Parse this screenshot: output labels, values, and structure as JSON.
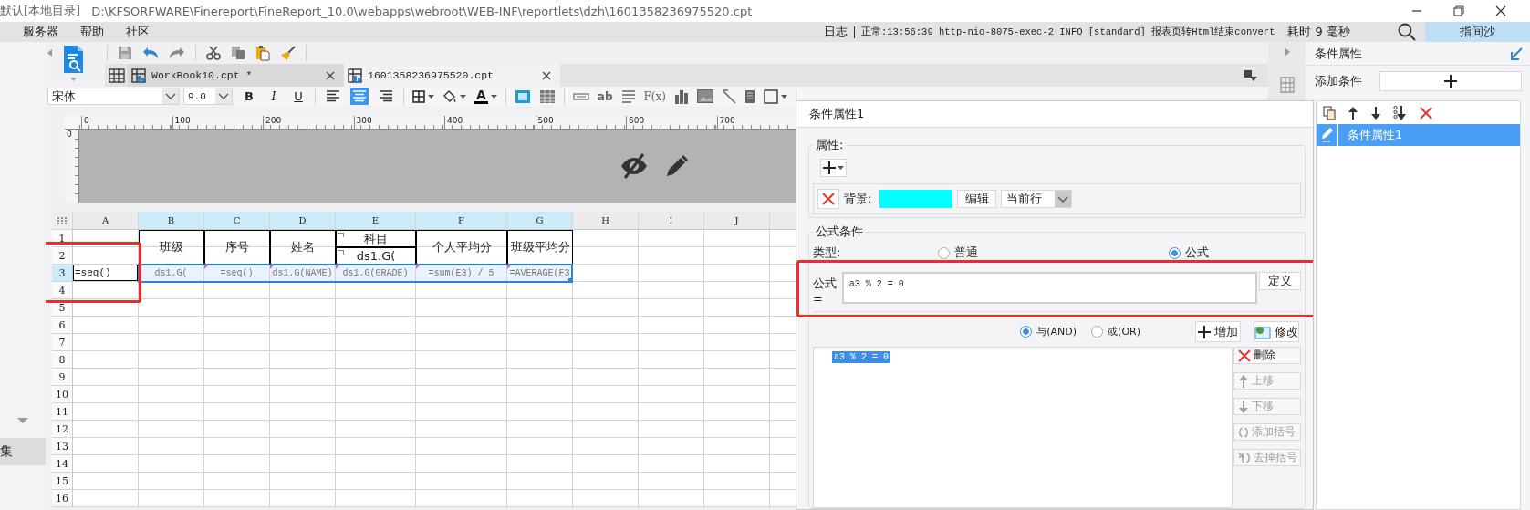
{
  "title_bar": {
    "title": "默认[本地目录]",
    "path": "D:\\KFSORFWARE\\Finereport\\FineReport_10.0\\webapps\\webroot\\WEB-INF\\reportlets\\dzh\\1601358236975520.cpt"
  },
  "menu": [
    "服务器",
    "帮助",
    "社区"
  ],
  "status": {
    "log": "日志",
    "message": "正常:13:56:39 http-nio-8075-exec-2 INFO [standard] 报表页转Html结束convert",
    "elapsed": "耗时 9 毫秒",
    "user": "指间沙"
  },
  "left_panel": {
    "tab": "集"
  },
  "tabs": [
    {
      "label": "WorkBook10.cpt *",
      "selected": false
    },
    {
      "label": "1601358236975520.cpt",
      "selected": true
    }
  ],
  "format_toolbar": {
    "font": "宋体",
    "size": "9.0",
    "styles": [
      {
        "kind": "bold",
        "label": "B"
      },
      {
        "kind": "italic",
        "label": "I"
      },
      {
        "kind": "underline",
        "label": "U"
      }
    ],
    "alignments": [
      {
        "kind": "left",
        "selected": false
      },
      {
        "kind": "center",
        "selected": true
      },
      {
        "kind": "right",
        "selected": false
      }
    ],
    "font_color": "A",
    "text_tool": "ab",
    "formula_tool": "F(x)"
  },
  "ruler": {
    "ticks": [
      "0",
      "100",
      "200",
      "300",
      "400",
      "500",
      "600",
      "700"
    ],
    "vertical": "0"
  },
  "sheet": {
    "columns": [
      {
        "label": "A",
        "selected": false
      },
      {
        "label": "B",
        "selected": true
      },
      {
        "label": "C",
        "selected": true
      },
      {
        "label": "D",
        "selected": true
      },
      {
        "label": "E",
        "selected": true
      },
      {
        "label": "F",
        "selected": true
      },
      {
        "label": "G",
        "selected": true
      },
      {
        "label": "H",
        "selected": false
      },
      {
        "label": "I",
        "selected": false
      },
      {
        "label": "J",
        "selected": false
      }
    ],
    "rows": [
      {
        "label": "1",
        "selected": false,
        "cells": [
          {
            "kind": "blank"
          },
          {
            "kind": "tall_header",
            "text": "班级",
            "selected": false
          },
          {
            "kind": "tall_header",
            "text": "序号",
            "selected": false
          },
          {
            "kind": "tall_header",
            "text": "姓名",
            "selected": false
          },
          {
            "kind": "expand",
            "text": "科目",
            "selected": false
          },
          {
            "kind": "tall_header",
            "text": "个人平均分",
            "selected": false
          },
          {
            "kind": "tall_header",
            "text": "班级平均分",
            "selected": false
          }
        ]
      },
      {
        "label": "2",
        "selected": false,
        "cells": [
          {
            "kind": "blank"
          },
          {
            "kind": "merged"
          },
          {
            "kind": "merged"
          },
          {
            "kind": "merged"
          },
          {
            "kind": "expand",
            "text": "ds1.G(",
            "selected": false
          },
          {
            "kind": "merged"
          },
          {
            "kind": "merged"
          }
        ]
      },
      {
        "label": "3",
        "selected": true,
        "cells": [
          {
            "kind": "formula",
            "text": "=seq()",
            "selected": false,
            "highlighted": true
          },
          {
            "kind": "data",
            "text": "ds1.G(",
            "selected": true
          },
          {
            "kind": "data",
            "text": "=seq()",
            "selected": true
          },
          {
            "kind": "data",
            "text": "ds1.G(NAME)",
            "selected": true
          },
          {
            "kind": "data",
            "text": "ds1.G(GRADE)",
            "selected": true
          },
          {
            "kind": "data",
            "text": "=sum(E3) / 5",
            "selected": true
          },
          {
            "kind": "data",
            "text": "=AVERAGE(F3",
            "selected": true
          }
        ]
      },
      {
        "label": "4",
        "selected": false
      },
      {
        "label": "5",
        "selected": false
      },
      {
        "label": "6",
        "selected": false
      },
      {
        "label": "7",
        "selected": false
      },
      {
        "label": "8",
        "selected": false
      },
      {
        "label": "9",
        "selected": false
      },
      {
        "label": "10",
        "selected": false
      },
      {
        "label": "11",
        "selected": false
      },
      {
        "label": "12",
        "selected": false
      },
      {
        "label": "13",
        "selected": false
      },
      {
        "label": "14",
        "selected": false
      },
      {
        "label": "15",
        "selected": false
      },
      {
        "label": "16",
        "selected": false
      }
    ]
  },
  "dialog": {
    "title": "条件属性1",
    "attributes": {
      "legend": "属性:",
      "property": "背景:",
      "color": "#00ffff",
      "edit": "编辑",
      "scope": "当前行"
    },
    "condition": {
      "legend": "公式条件",
      "type_label": "类型:",
      "types": [
        {
          "label": "普通",
          "selected": false
        },
        {
          "label": "公式",
          "selected": true
        }
      ],
      "formula_label": "公式=",
      "formula": "a3 % 2 = 0",
      "define": "定义",
      "highlighted": true
    },
    "logic": [
      {
        "label": "与(AND)",
        "selected": true
      },
      {
        "label": "或(OR)",
        "selected": false
      }
    ],
    "add": "增加",
    "modify": "修改",
    "conditions": [
      {
        "text": "a3 % 2 = 0",
        "selected": true
      }
    ],
    "actions": [
      {
        "kind": "delete",
        "label": "删除",
        "disabled": false
      },
      {
        "kind": "up",
        "label": "上移",
        "disabled": true
      },
      {
        "kind": "down",
        "label": "下移",
        "disabled": true
      },
      {
        "kind": "add_brackets",
        "label": "添加括号",
        "disabled": true
      },
      {
        "kind": "remove_brackets",
        "label": "去掉括号",
        "disabled": true
      }
    ]
  },
  "panel": {
    "title": "条件属性",
    "add_label": "添加条件",
    "items": [
      {
        "label": "条件属性1",
        "selected": true
      }
    ]
  }
}
